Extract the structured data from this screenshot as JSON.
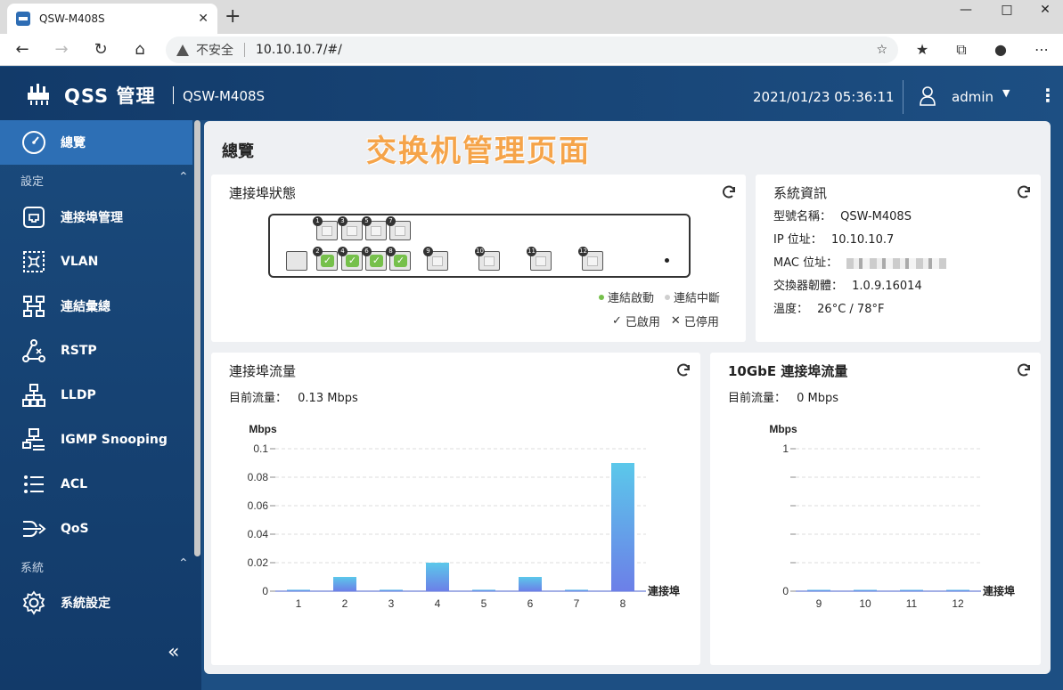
{
  "browser": {
    "tab_title": "QSW-M408S",
    "tab_close": "✕",
    "new_tab": "+",
    "security": "不安全",
    "url": "10.10.10.7/#/"
  },
  "header": {
    "brand": "QSS 管理",
    "model": "QSW-M408S",
    "datetime": "2021/01/23  05:36:11",
    "user": "admin"
  },
  "sidebar": {
    "active": "總覽",
    "section_settings": "設定",
    "items": [
      "連接埠管理",
      "VLAN",
      "連結彙總",
      "RSTP",
      "LLDP",
      "IGMP  Snooping",
      "ACL",
      "QoS"
    ],
    "section_system": "系統",
    "system_items": [
      "系統設定"
    ]
  },
  "main": {
    "page_title": "總覽",
    "overlay_title": "交换机管理页面",
    "port_status": {
      "title": "連接埠狀態",
      "top_ports": [
        "1",
        "3",
        "5",
        "7"
      ],
      "bottom_ports": [
        "2",
        "4",
        "6",
        "8",
        "9",
        "10",
        "11",
        "12"
      ],
      "linked_ports": [
        "2",
        "4",
        "6",
        "8"
      ],
      "legend_up": "連結啟動",
      "legend_down": "連結中斷",
      "legend_enabled": "已啟用",
      "legend_disabled": "已停用",
      "color_up": "#76c04b",
      "color_down": "#cfcfcf"
    },
    "system_info": {
      "title": "系統資訊",
      "model_label": "型號名稱：",
      "model_value": "QSW-M408S",
      "ip_label": "IP 位址：",
      "ip_value": "10.10.10.7",
      "mac_label": "MAC 位址：",
      "firmware_label": "交換器韌體：",
      "firmware_value": "1.0.9.16014",
      "temp_label": "溫度：",
      "temp_value": "26°C / 78°F"
    },
    "port_traffic": {
      "title": "連接埠流量",
      "current_label": "目前流量：",
      "current_value": "0.13  Mbps"
    },
    "traffic_10g": {
      "title": "10GbE  連接埠流量",
      "current_label": "目前流量：",
      "current_value": "0  Mbps"
    }
  },
  "chart_data": [
    {
      "type": "bar",
      "ylabel": "Mbps",
      "xlabel": "連接埠",
      "categories": [
        "1",
        "2",
        "3",
        "4",
        "5",
        "6",
        "7",
        "8"
      ],
      "values": [
        0.001,
        0.01,
        0.001,
        0.02,
        0.001,
        0.01,
        0.001,
        0.09
      ],
      "yticks": [
        "0",
        "0.02",
        "0.04",
        "0.06",
        "0.08",
        "0.1"
      ],
      "ylim": [
        0,
        0.1
      ],
      "grid": true
    },
    {
      "type": "bar",
      "ylabel": "Mbps",
      "xlabel": "連接埠",
      "categories": [
        "9",
        "10",
        "11",
        "12"
      ],
      "values": [
        0.001,
        0.001,
        0.001,
        0.001
      ],
      "yticks": [
        "0",
        "1"
      ],
      "ylim": [
        0,
        1
      ],
      "grid": true
    }
  ]
}
